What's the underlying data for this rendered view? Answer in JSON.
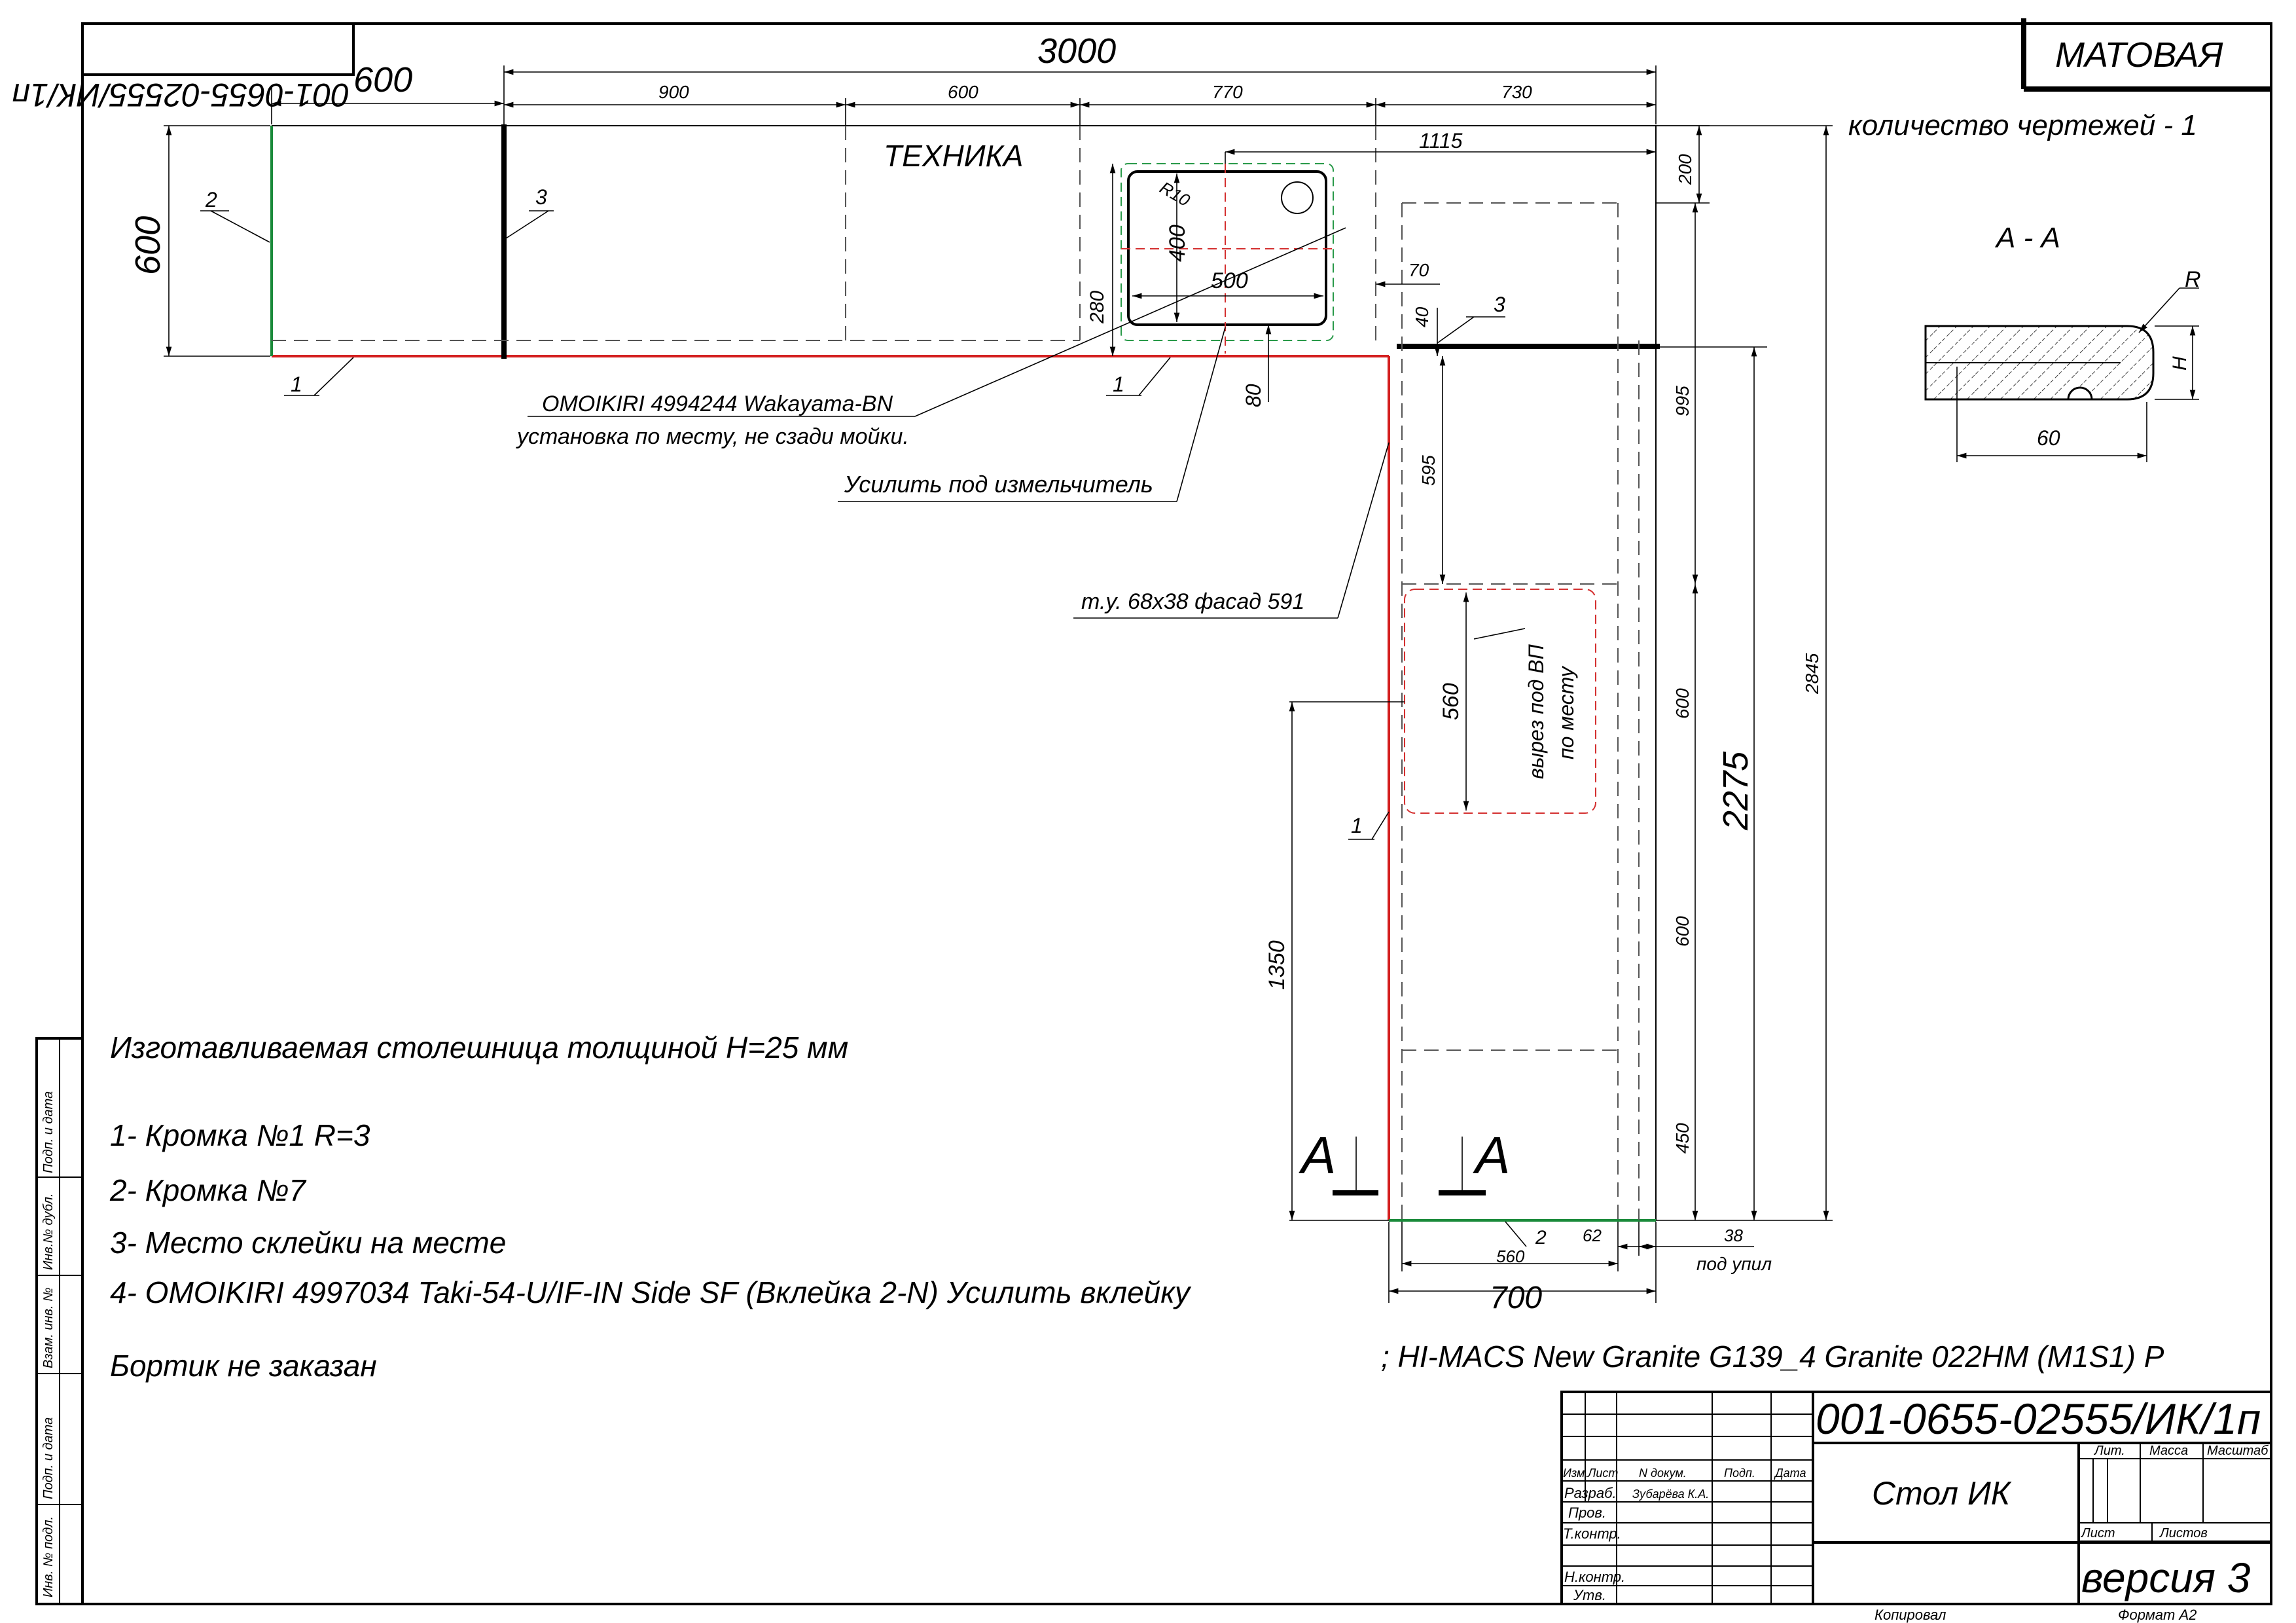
{
  "drawing_number": "001-0655-02555/ИК/1п",
  "finish": "МАТОВАЯ",
  "drawings_count": "количество чертежей - 1",
  "zone_label": "ТЕХНИКА",
  "section": {
    "title": "А - А",
    "r_label": "R",
    "h_label": "H",
    "width_label": "60"
  },
  "sink": {
    "r_label": "R10",
    "depth": "400",
    "width": "500"
  },
  "dimensions": {
    "overall_length": "3000",
    "left_depth": "600",
    "left_segment": "600",
    "seg1": "900",
    "seg2": "600",
    "seg3": "770",
    "seg4": "730",
    "sink_offset": "1115",
    "corner_depth": "200",
    "d280": "280",
    "d70": "70",
    "d40": "40",
    "d80": "80",
    "d995": "995",
    "d595": "595",
    "d600a": "600",
    "d2275": "2275",
    "d2845": "2845",
    "d600b": "600",
    "d450": "450",
    "d1350": "1350",
    "hob_depth": "560",
    "bottom_560": "560",
    "d62": "62",
    "d38": "38",
    "return_width": "700"
  },
  "callouts": {
    "c1": "1",
    "c2": "2",
    "c3": "3",
    "c1b": "1",
    "c3b": "3",
    "c1c": "1",
    "c2b": "2",
    "sink_model": "OMOIKIRI 4994244 Wakayama-BN",
    "sink_note": "установка по месту, не сзади мойки.",
    "reinforce": "Усилить под измельчитель",
    "tu_facade": "т.у. 68х38 фасад 591",
    "cutout_line1": "вырез под ВП",
    "cutout_line2": "по месту",
    "seal": "под упил"
  },
  "section_marks": {
    "left": "А",
    "right": "А"
  },
  "notes": {
    "thickness": "Изготавливаемая столешница толщиной Н=25 мм",
    "items": [
      "1- Кромка №1 R=3",
      "2- Кромка №7",
      "3- Место склейки на месте",
      "4- OMOIKIRI 4997034 Taki-54-U/IF-IN Side SF (Вклейка 2-N) Усилить вклейку"
    ],
    "no_backsplash": "Бортик не заказан"
  },
  "material": "; HI-MACS New Granite G139_4 Granite 022HM (M1S1) P",
  "title_block": {
    "doc_number": "001-0655-02555/ИК/1п",
    "name": "Стол ИК",
    "version": "версия 3",
    "headers": [
      "Изм.",
      "Лист",
      "N докум.",
      "Подп.",
      "Дата"
    ],
    "rows": [
      "Разраб.",
      "Пров.",
      "Т.контр.",
      "Н.контр.",
      "Утв."
    ],
    "developer": "Зубарёва К.А.",
    "lit": "Лит.",
    "mass": "Масса",
    "scale": "Масштаб",
    "sheet": "Лист",
    "sheets": "Листов",
    "copied": "Копировал",
    "format": "Формат А2"
  },
  "side_stamps": [
    "Подп. и дата",
    "Инв.№ дубл.",
    "Взам. инв. №",
    "Подп. и дата",
    "Инв. № подл."
  ]
}
